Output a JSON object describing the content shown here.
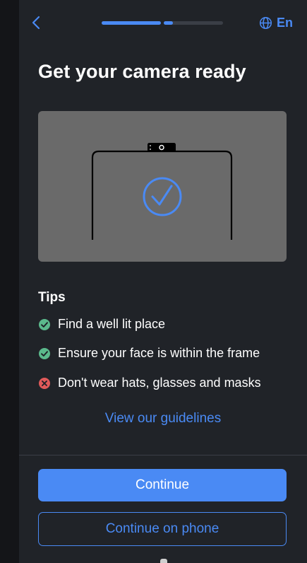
{
  "header": {
    "back_icon": "chevron-left-icon",
    "language_icon": "globe-icon",
    "language_label": "En",
    "progress": {
      "steps": 2,
      "current_step": 2,
      "current_step_fraction": 0.15
    }
  },
  "title": "Get your camera ready",
  "illustration": {
    "icons": [
      "webcam-icon",
      "monitor-frame-icon",
      "check-circle-icon"
    ]
  },
  "tips": {
    "heading": "Tips",
    "items": [
      {
        "text": "Find a well lit place",
        "status": "ok",
        "icon": "check-circle-icon",
        "color": "#5bb98c"
      },
      {
        "text": "Ensure your face is within the frame",
        "status": "ok",
        "icon": "check-circle-icon",
        "color": "#5bb98c"
      },
      {
        "text": "Don't wear hats, glasses and masks",
        "status": "bad",
        "icon": "x-circle-icon",
        "color": "#e05a5a"
      }
    ]
  },
  "guidelines_link": "View our guidelines",
  "actions": {
    "continue_label": "Continue",
    "continue_on_phone_label": "Continue on phone"
  },
  "colors": {
    "accent": "#4a8af4",
    "background": "#202328",
    "illustration_bg": "#6a6a6a"
  }
}
